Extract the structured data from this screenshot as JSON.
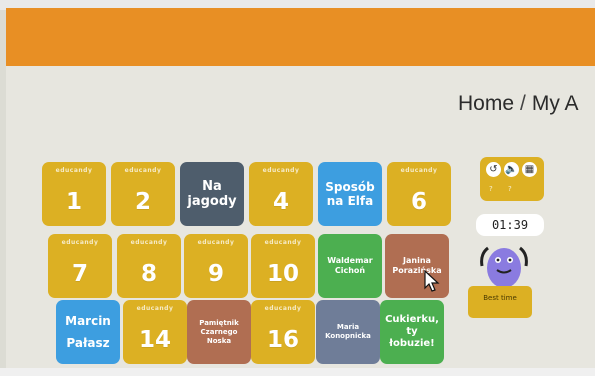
{
  "breadcrumb": {
    "home": "Home",
    "separator": "/",
    "current": "My A"
  },
  "tiles": [
    {
      "label": "1",
      "watermark": "educandy"
    },
    {
      "label": "2",
      "watermark": "educandy"
    },
    {
      "label": "Na jagody"
    },
    {
      "label": "4",
      "watermark": "educandy"
    },
    {
      "label": "Sposób na Elfa"
    },
    {
      "label": "6",
      "watermark": "educandy"
    },
    {
      "label": "7",
      "watermark": "educandy"
    },
    {
      "label": "8",
      "watermark": "educandy"
    },
    {
      "label": "9",
      "watermark": "educandy"
    },
    {
      "label": "10",
      "watermark": "educandy"
    },
    {
      "label": "Waldemar Cichoń"
    },
    {
      "label": "Janina Porazińska"
    },
    {
      "label": "Marcin Pałasz"
    },
    {
      "label": "14",
      "watermark": "educandy"
    },
    {
      "label": "Pamiętnik Czarnego Noska"
    },
    {
      "label": "16",
      "watermark": "educandy"
    },
    {
      "label": "Maria Konopnicka"
    },
    {
      "label": "Cukierku, ty łobuzie!"
    }
  ],
  "tools": {
    "icons": [
      "undo-icon",
      "sound-icon",
      "grid-icon"
    ],
    "sub_left": "?",
    "sub_right": "?"
  },
  "timer": "01:39",
  "best_time_label": "Best time",
  "colors": {
    "top_bar": "#e88f24",
    "tile_yellow": "#dcb023",
    "tile_gray": "#4e5d6c",
    "tile_blue": "#3d9ee0",
    "tile_green": "#4caf50",
    "tile_brown": "#b06e52",
    "tile_slate": "#6f7d98",
    "mascot": "#8a7be0"
  }
}
